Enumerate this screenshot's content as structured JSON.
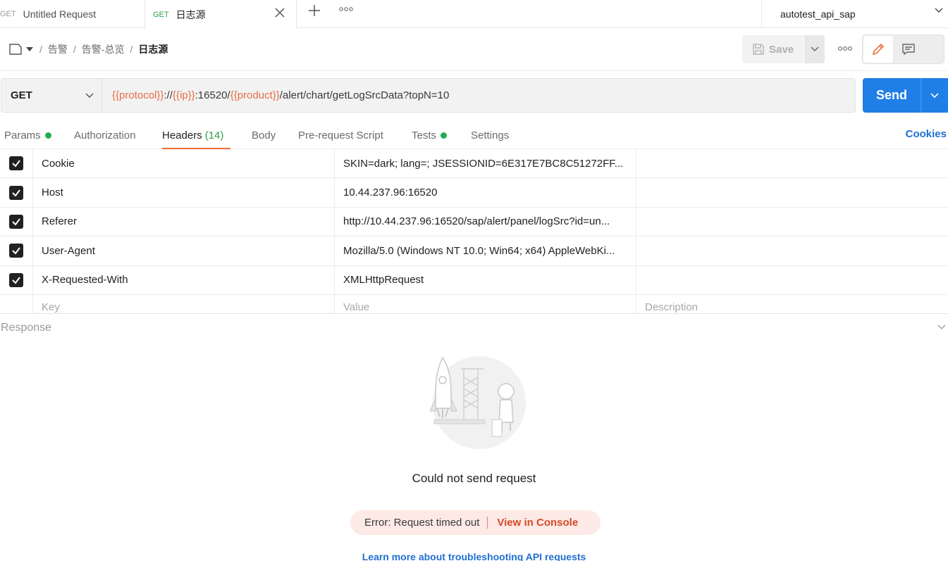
{
  "tabs": [
    {
      "method": "GET",
      "name": "Untitled Request"
    },
    {
      "method": "GET",
      "name": "日志源"
    }
  ],
  "environment": "autotest_api_sap",
  "breadcrumb": {
    "items": [
      "告警",
      "告警-总览"
    ],
    "current": "日志源",
    "separator": "/"
  },
  "toolbar": {
    "save_label": "Save"
  },
  "request": {
    "method": "GET",
    "url_parts": [
      {
        "text": "{{protocol}}",
        "variable": true
      },
      {
        "text": "://",
        "variable": false
      },
      {
        "text": "{{ip}}",
        "variable": true
      },
      {
        "text": ":16520/",
        "variable": false
      },
      {
        "text": "{{product}}",
        "variable": true
      },
      {
        "text": "/alert/chart/getLogSrcData?topN=10",
        "variable": false
      }
    ],
    "send_label": "Send"
  },
  "request_tabs": [
    {
      "label": "Params",
      "dot": true
    },
    {
      "label": "Authorization"
    },
    {
      "label": "Headers",
      "count": "(14)",
      "active": true
    },
    {
      "label": "Body"
    },
    {
      "label": "Pre-request Script"
    },
    {
      "label": "Tests",
      "dot": true
    },
    {
      "label": "Settings"
    }
  ],
  "cookies_label": "Cookies",
  "headers": [
    {
      "key": "Cookie",
      "value": "SKIN=dark; lang=; JSESSIONID=6E317E7BC8C51272FF...",
      "checked": true
    },
    {
      "key": "Host",
      "value": "10.44.237.96:16520",
      "checked": true
    },
    {
      "key": "Referer",
      "value": "http://10.44.237.96:16520/sap/alert/panel/logSrc?id=un...",
      "checked": true
    },
    {
      "key": "User-Agent",
      "value": "Mozilla/5.0 (Windows NT 10.0; Win64; x64) AppleWebKi...",
      "checked": true
    },
    {
      "key": "X-Requested-With",
      "value": "XMLHttpRequest",
      "checked": true
    }
  ],
  "header_placeholders": {
    "key": "Key",
    "value": "Value",
    "description": "Description"
  },
  "response": {
    "label": "Response",
    "message": "Could not send request",
    "error": "Error: Request timed out",
    "console_link": "View in Console",
    "learn_link": "Learn more about troubleshooting API requests"
  },
  "colors": {
    "accent": "#1f7fe6",
    "variable": "#e86d48",
    "tab_underline": "#f26b3a",
    "dot": "#1fae4f",
    "error_bg": "#fde9e5"
  }
}
